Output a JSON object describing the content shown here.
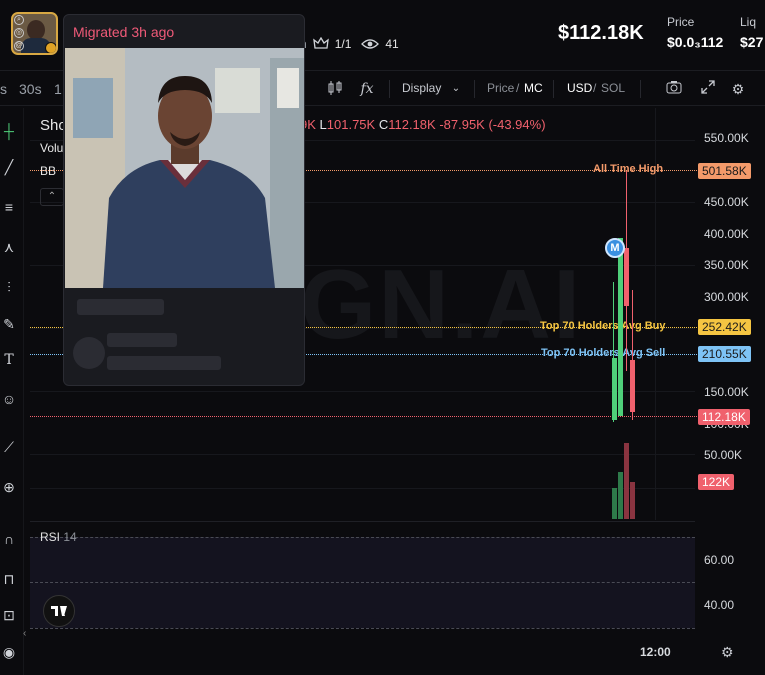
{
  "header": {
    "holders_ratio": "1/1",
    "watchers": "41",
    "age_fragment": "h",
    "market_cap": "$112.18K",
    "price_label": "Price",
    "price_value": "$0.0₃112",
    "liq_label": "Liq",
    "liq_value": "$27"
  },
  "toolbar": {
    "timeframes": [
      "s",
      "30s",
      "1"
    ],
    "display_label": "Display",
    "price_label": "Price",
    "mc_label": "MC",
    "usd_label": "USD",
    "sol_label": "SOL"
  },
  "chart": {
    "symbol_fragment": "Sho",
    "volume_fragment": "Volu",
    "bb_fragment": "BB",
    "ohlc": {
      "h_fragment": "9K",
      "l_label": "L",
      "l_value": "101.75K",
      "c_label": "C",
      "c_value": "112.18K",
      "change": "-87.95K (-43.94%)"
    },
    "watermark": "GN.AI",
    "marker_letter": "M",
    "lines": {
      "ath_label": "All Time High",
      "ath_value": "501.58K",
      "buy_label": "Top 70 Holders Avg Buy",
      "buy_value": "252.42K",
      "sell_label": "Top 70 Holders Avg Sell",
      "sell_value": "210.55K",
      "current_value": "112.18K",
      "volume_value": "122K"
    },
    "y_ticks": [
      "550.00K",
      "450.00K",
      "400.00K",
      "350.00K",
      "300.00K",
      "150.00K",
      "100.00K",
      "50.00K"
    ],
    "colors": {
      "up": "#4fcf7a",
      "down": "#f0616d",
      "ath": "#f39a6a",
      "buy": "#f5c542",
      "sell": "#7ec3f5"
    }
  },
  "rsi": {
    "label": "RSI",
    "period": "14",
    "ticks": [
      "60.00",
      "40.00"
    ]
  },
  "time_axis": {
    "label": "12:00"
  },
  "popup": {
    "title": "Migrated 3h ago"
  }
}
